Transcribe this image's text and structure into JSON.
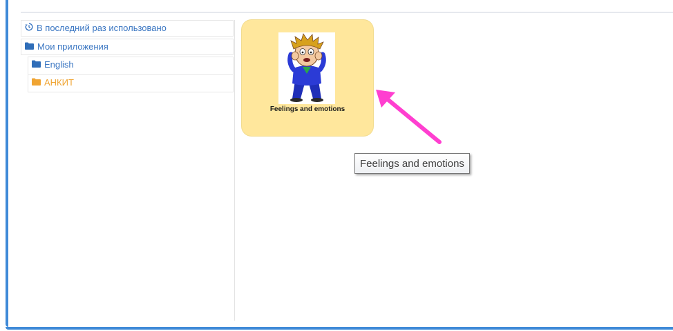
{
  "sidebar": {
    "items": [
      {
        "label": "В последний раз использовано",
        "icon": "history-icon"
      },
      {
        "label": "Мои приложения",
        "icon": "folder-icon"
      },
      {
        "label": "English",
        "icon": "folder-icon"
      },
      {
        "label": "АНКИТ",
        "icon": "folder-icon"
      }
    ]
  },
  "apps": [
    {
      "label": "Feelings and emotions",
      "icon": "scared-boy-thumbnail"
    }
  ],
  "tooltip": {
    "text": "Feelings and emotions"
  },
  "colors": {
    "link_blue": "#3a76c2",
    "active_orange": "#f0a432",
    "tile_yellow": "#ffe79c",
    "accent_blue": "#3f8ad8",
    "annotation_arrow": "#ff3fd0"
  }
}
